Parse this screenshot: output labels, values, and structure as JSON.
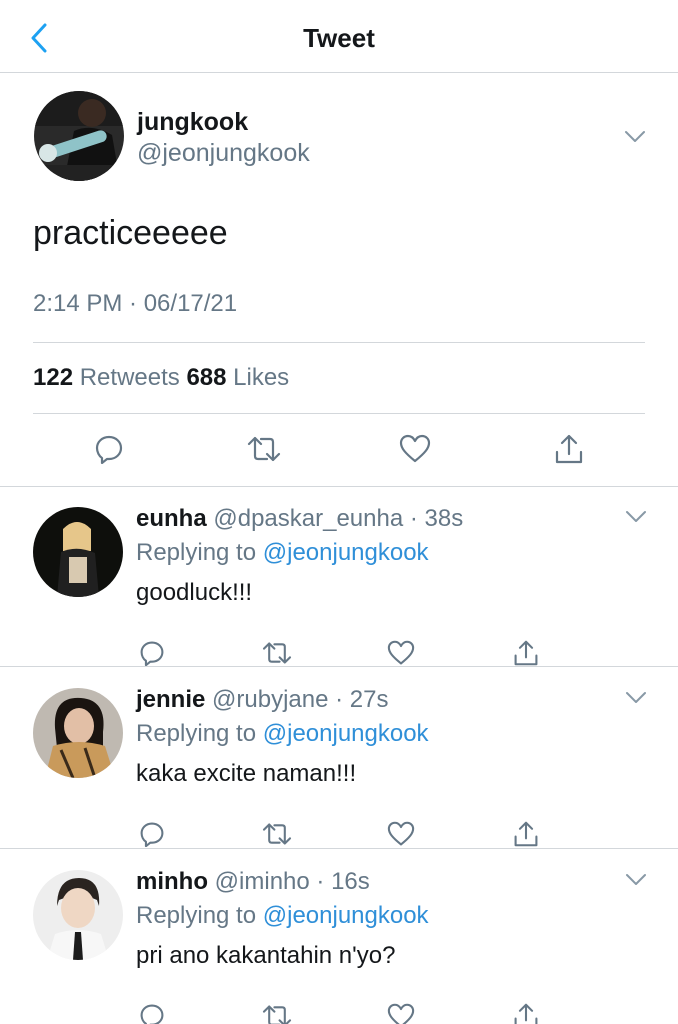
{
  "nav": {
    "title": "Tweet"
  },
  "tweet": {
    "author_name": "jungkook",
    "author_handle": "@jeonjungkook",
    "text": "practiceeeee",
    "timestamp": "2:14 PM · 06/17/21",
    "retweets": "122",
    "retweets_label": "Retweets",
    "likes": "688",
    "likes_label": "Likes"
  },
  "replies": [
    {
      "name": "eunha",
      "handle": "@dpaskar_eunha",
      "time": "38s",
      "replying_label": "Replying to",
      "replying_to": "@jeonjungkook",
      "text": "goodluck!!!"
    },
    {
      "name": "jennie",
      "handle": "@rubyjane",
      "time": "27s",
      "replying_label": "Replying to",
      "replying_to": "@jeonjungkook",
      "text": "kaka excite naman!!!"
    },
    {
      "name": "minho",
      "handle": "@iminho",
      "time": "16s",
      "replying_label": "Replying to",
      "replying_to": "@jeonjungkook",
      "text": "pri ano kakantahin n'yo?"
    }
  ],
  "icons": {
    "back": "chevron-left-icon",
    "caret": "chevron-down-icon",
    "reply": "reply-icon",
    "retweet": "retweet-icon",
    "like": "heart-icon",
    "share": "share-icon"
  },
  "colors": {
    "accent": "#1da1f2",
    "mention": "#2f8fd8",
    "secondary_text": "#657786",
    "border": "#d3d7db"
  }
}
